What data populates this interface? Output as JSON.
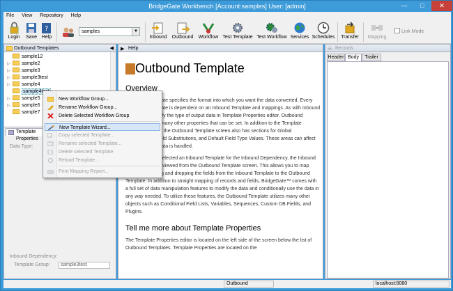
{
  "window": {
    "title": "BridgeGate Workbench [Account:samples] User: [admin]"
  },
  "menu": [
    "File",
    "View",
    "Repository",
    "Help"
  ],
  "toolbar": {
    "login": "Login",
    "save": "Save",
    "help": "Help",
    "account_value": "samples",
    "inbound": "Inbound",
    "outbound": "Outbound",
    "workflow": "Workflow",
    "test_template": "Test Template",
    "test_workflow": "Test Workflow",
    "services": "Services",
    "schedules": "Schedules",
    "transfer": "Transfer",
    "mapping": "Mapping",
    "link_mode": "Link Mode"
  },
  "left_panel": {
    "title": "Outbound Templates",
    "tree": [
      "sample12",
      "sample2",
      "sample3",
      "sample3test",
      "sample4",
      "sample4test",
      "sample5",
      "sample6",
      "sample7"
    ],
    "selected": "sample4test"
  },
  "properties": {
    "tab": "Template Properties",
    "data_type_label": "Data Type:",
    "inbound_dependency_label": "Inbound Dependency:",
    "template_group_label": "Template Group:",
    "template_group_value": "sample3test"
  },
  "context_menu": [
    {
      "label": "New Workflow Group...",
      "disabled": false
    },
    {
      "label": "Rename Workflow Group...",
      "disabled": false
    },
    {
      "label": "Delete Selected Workflow Group",
      "disabled": false
    },
    {
      "label": "New Template Wizard...",
      "disabled": false,
      "highlighted": true
    },
    {
      "label": "Copy selected Template...",
      "disabled": true
    },
    {
      "label": "Rename selected Template...",
      "disabled": true
    },
    {
      "label": "Delete selected Template",
      "disabled": true
    },
    {
      "label": "Reload Template...",
      "disabled": true
    },
    {
      "label": "Print Mapping Report...",
      "disabled": true
    }
  ],
  "help_panel": {
    "tab": "Help",
    "heading": "Outbound Template",
    "section1": "Overview",
    "p1": "Outbound Template specifies the format into which you want the data converted. Every Outbound Template is dependent on an Inbound Template and mappings. As with Inbound Templates, specify the type of output data in Template Properties editor. Outbound Templates have many other properties that can be set. In addition to the Template Properties editor, the Outbound Template screen also has sections for Global Substitutions, Field Substitutions, and Default Field Type Values. These areas can affect how translated data is handled.",
    "p2": "Once you have selected an Inbound Template for the Inbound Dependency, the Inbound Template can be viewed from the Outbound Template screen. This allows you to map fields by dragging and dropping the fields from the Inbound Template to the Outbound Template. In addition to straight mapping of records and fields, BridgeGate™ comes with a full set of data manipulation features to modify the data and conditionally use the data in any way needed. To utilize these features, the Outbound Template utilizes many other objects such as Conditional Field Lists, Variables, Sequences, Custom DB Fields, and Plugins.",
    "section2": "Tell me more about Template Properties",
    "p3": "The Template Properties editor is located on the left side of the screen below the list of Outbound Templates. Template Properties are located on the"
  },
  "records_panel": {
    "title": "Records",
    "tabs": [
      "Header",
      "Body",
      "Trailer"
    ],
    "active_tab": "Body"
  },
  "status": {
    "mode": "Outbound",
    "server": "localhost:8080"
  }
}
